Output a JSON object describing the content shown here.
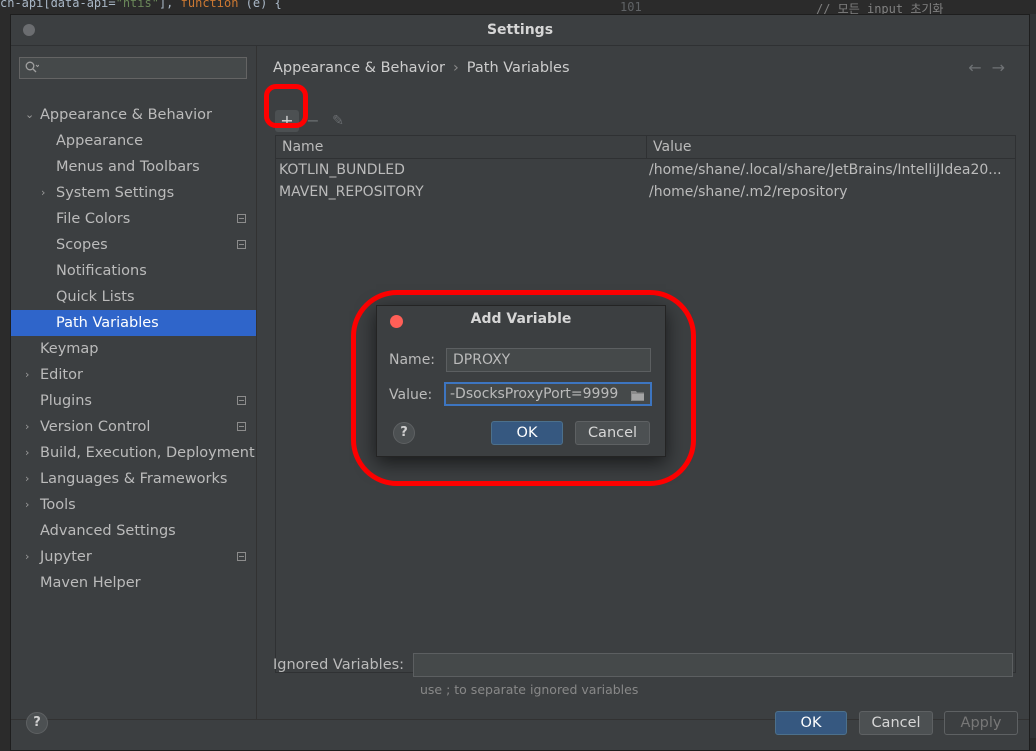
{
  "background": {
    "top_code": {
      "a": "ch-api[data-api=",
      "b": "\"ntis\"",
      "c": "], ",
      "d": "function",
      "e": " (e) {"
    },
    "line_number": "101",
    "comment": "// 모든 input 초기화"
  },
  "window": {
    "title": "Settings"
  },
  "sidebar": {
    "items": [
      {
        "label": "Appearance & Behavior",
        "expanded": true
      },
      {
        "label": "Appearance"
      },
      {
        "label": "Menus and Toolbars"
      },
      {
        "label": "System Settings"
      },
      {
        "label": "File Colors"
      },
      {
        "label": "Scopes"
      },
      {
        "label": "Notifications"
      },
      {
        "label": "Quick Lists"
      },
      {
        "label": "Path Variables",
        "selected": true
      },
      {
        "label": "Keymap"
      },
      {
        "label": "Editor"
      },
      {
        "label": "Plugins"
      },
      {
        "label": "Version Control"
      },
      {
        "label": "Build, Execution, Deployment"
      },
      {
        "label": "Languages & Frameworks"
      },
      {
        "label": "Tools"
      },
      {
        "label": "Advanced Settings"
      },
      {
        "label": "Jupyter"
      },
      {
        "label": "Maven Helper"
      }
    ]
  },
  "breadcrumb": {
    "parent": "Appearance & Behavior",
    "separator": "›",
    "current": "Path Variables"
  },
  "nav": {
    "back": "←",
    "forward": "→"
  },
  "toolbar": {
    "add": "+",
    "remove": "−",
    "edit": "✎"
  },
  "table": {
    "headers": [
      "Name",
      "Value"
    ],
    "rows": [
      {
        "name": "KOTLIN_BUNDLED",
        "value": "/home/shane/.local/share/JetBrains/IntelliJIdea20..."
      },
      {
        "name": "MAVEN_REPOSITORY",
        "value": "/home/shane/.m2/repository"
      }
    ]
  },
  "ignored": {
    "label": "Ignored Variables:",
    "value": "",
    "hint": "use ; to separate ignored variables"
  },
  "footer": {
    "help": "?",
    "ok": "OK",
    "cancel": "Cancel",
    "apply": "Apply"
  },
  "dialog": {
    "title": "Add Variable",
    "name_label": "Name:",
    "name_value": "DPROXY",
    "value_label": "Value:",
    "value_value": "-DsocksProxyPort=9999",
    "help": "?",
    "ok": "OK",
    "cancel": "Cancel"
  },
  "colors": {
    "accent": "#2f65ca",
    "primary_button": "#365880",
    "annotation": "#ff0000"
  }
}
